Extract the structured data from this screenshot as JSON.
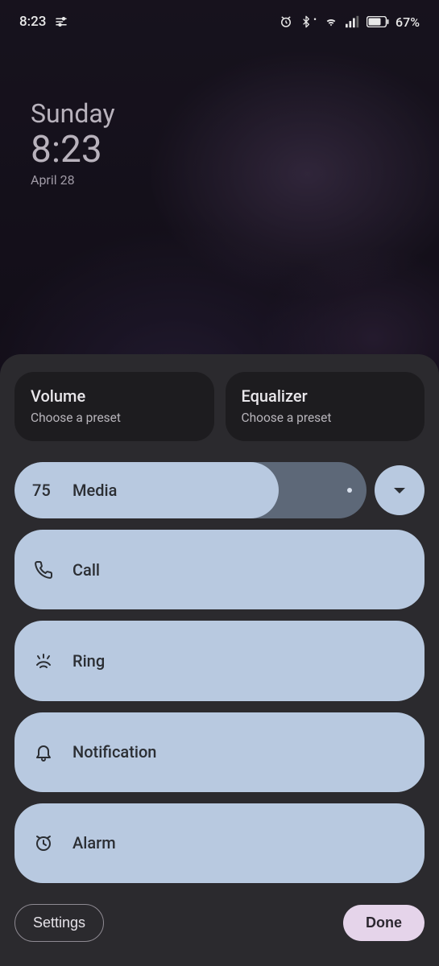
{
  "status": {
    "time": "8:23",
    "battery_pct": "67%"
  },
  "lock": {
    "day": "Sunday",
    "time": "8:23",
    "date": "April 28"
  },
  "panel": {
    "presets": [
      {
        "title": "Volume",
        "subtitle": "Choose a preset"
      },
      {
        "title": "Equalizer",
        "subtitle": "Choose a preset"
      }
    ],
    "media": {
      "value": "75",
      "label": "Media",
      "percent": 75
    },
    "rows": [
      {
        "icon": "phone-icon",
        "label": "Call"
      },
      {
        "icon": "ring-icon",
        "label": "Ring"
      },
      {
        "icon": "bell-icon",
        "label": "Notification"
      },
      {
        "icon": "alarm-icon",
        "label": "Alarm"
      }
    ],
    "settings_label": "Settings",
    "done_label": "Done"
  }
}
